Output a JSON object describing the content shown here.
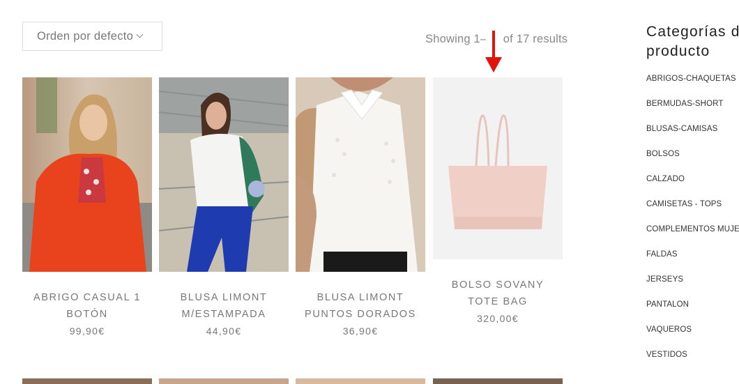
{
  "sort": {
    "label": "Orden por defecto"
  },
  "results": {
    "text": "Showing 1–12 of 17 results"
  },
  "products": [
    {
      "title_line1": "ABRIGO CASUAL 1",
      "title_line2": "BOTÓN",
      "price": "99,90€"
    },
    {
      "title_line1": "BLUSA LIMONT",
      "title_line2": "M/ESTAMPADA",
      "price": "44,90€"
    },
    {
      "title_line1": "BLUSA LIMONT",
      "title_line2": "PUNTOS DORADOS",
      "price": "36,90€"
    },
    {
      "title_line1": "BOLSO SOVANY",
      "title_line2": "TOTE BAG",
      "price": "320,00€"
    }
  ],
  "sidebar": {
    "title_line1": "Categorías de",
    "title_line2": "producto",
    "categories": [
      "ABRIGOS-CHAQUETAS",
      "BERMUDAS-SHORT",
      "BLUSAS-CAMISAS",
      "BOLSOS",
      "CALZADO",
      "CAMISETAS - TOPS",
      "COMPLEMENTOS MUJER",
      "FALDAS",
      "JERSEYS",
      "PANTALON",
      "VAQUEROS",
      "VESTIDOS"
    ]
  },
  "colors": {
    "annotation_arrow": "#e3120b",
    "coat": "#e8431c",
    "bag": "#f0cfc7"
  }
}
